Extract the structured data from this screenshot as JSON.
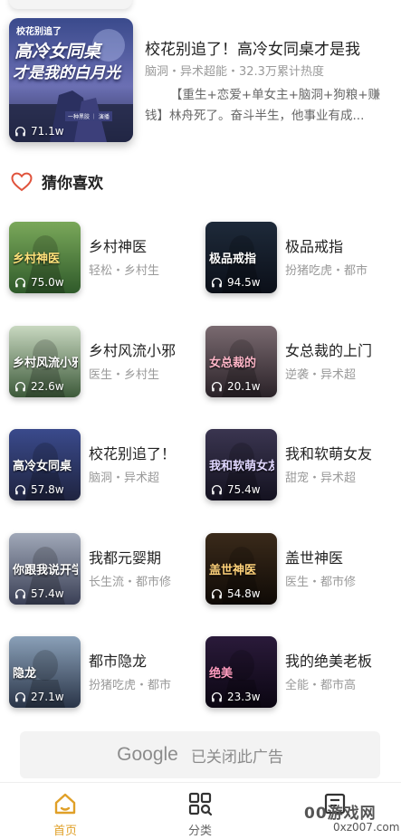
{
  "featured": {
    "title": "校花别追了！高冷女同桌才是我",
    "meta": "脑洞・异术超能・32.3万累计热度",
    "description": "【重生+恋爱+单女主+脑洞+狗粮+赚钱】林舟死了。奋斗半生，他事业有成...",
    "plays": "71.1w",
    "cover_line1": "高冷女同桌",
    "cover_line2": "才是我的白月光",
    "cover_tag": "校花别追了",
    "cover_author": "一种黑胶 ｜ 演播"
  },
  "section": {
    "title": "猜你喜欢",
    "icon": "heart-outline-icon",
    "icon_color": "#e0533c"
  },
  "books": [
    {
      "title": "乡村神医",
      "meta": "轻松・乡村生",
      "plays": "75.0w",
      "art": "乡村神医"
    },
    {
      "title": "极品戒指",
      "meta": "扮猪吃虎・都市",
      "plays": "94.5w",
      "art": "极品戒指"
    },
    {
      "title": "乡村风流小邪",
      "meta": "医生・乡村生",
      "plays": "22.6w",
      "art": "乡村风流小邪医"
    },
    {
      "title": "女总裁的上门",
      "meta": "逆袭・异术超",
      "plays": "20.1w",
      "art": "女总裁的"
    },
    {
      "title": "校花别追了！",
      "meta": "脑洞・异术超",
      "plays": "57.8w",
      "art": "高冷女同桌"
    },
    {
      "title": "我和软萌女友",
      "meta": "甜宠・异术超",
      "plays": "75.4w",
      "art": "我和软萌女友"
    },
    {
      "title": "我都元婴期",
      "meta": "长生流・都市修",
      "plays": "57.4w",
      "art": "你跟我说开学"
    },
    {
      "title": "盖世神医",
      "meta": "医生・都市修",
      "plays": "54.8w",
      "art": "盖世神医"
    },
    {
      "title": "都市隐龙",
      "meta": "扮猪吃虎・都市",
      "plays": "27.1w",
      "art": "隐龙"
    },
    {
      "title": "我的绝美老板",
      "meta": "全能・都市高",
      "plays": "23.3w",
      "art": "绝美"
    }
  ],
  "ad": {
    "logo": "Google",
    "text": "已关闭此广告"
  },
  "nav": {
    "items": [
      {
        "label": "首页",
        "icon": "home-icon",
        "active": true
      },
      {
        "label": "分类",
        "icon": "category-search-icon",
        "active": false
      },
      {
        "label": "",
        "icon": "bookshelf-icon",
        "active": false
      }
    ],
    "active_color": "#e0a028"
  },
  "watermark": {
    "top": "00游戏网",
    "bottom": "0xz007.com"
  }
}
